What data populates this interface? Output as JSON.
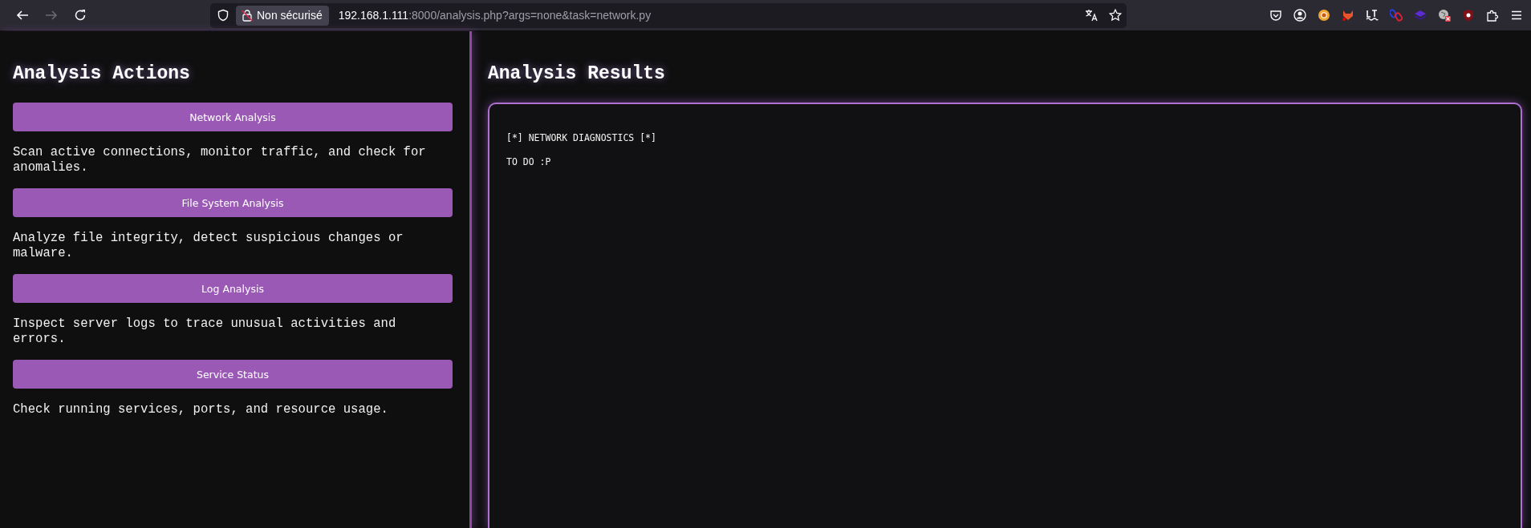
{
  "browser": {
    "back_disabled": false,
    "forward_disabled": true,
    "security_label": "Non sécurisé",
    "url_host": "192.168.1.111",
    "url_rest": ":8000/analysis.php?args=none&task=network.py",
    "bookmarked": false
  },
  "actions": {
    "title": "Analysis Actions",
    "items": [
      {
        "button": "Network Analysis",
        "description": "Scan active connections, monitor traffic, and check for anomalies."
      },
      {
        "button": "File System Analysis",
        "description": "Analyze file integrity, detect suspicious changes or malware."
      },
      {
        "button": "Log Analysis",
        "description": "Inspect server logs to trace unusual activities and errors."
      },
      {
        "button": "Service Status",
        "description": "Check running services, ports, and resource usage."
      }
    ]
  },
  "results": {
    "title": "Analysis Results",
    "lines": [
      "[*] NETWORK DIAGNOSTICS [*]",
      "TO DO :P"
    ]
  }
}
